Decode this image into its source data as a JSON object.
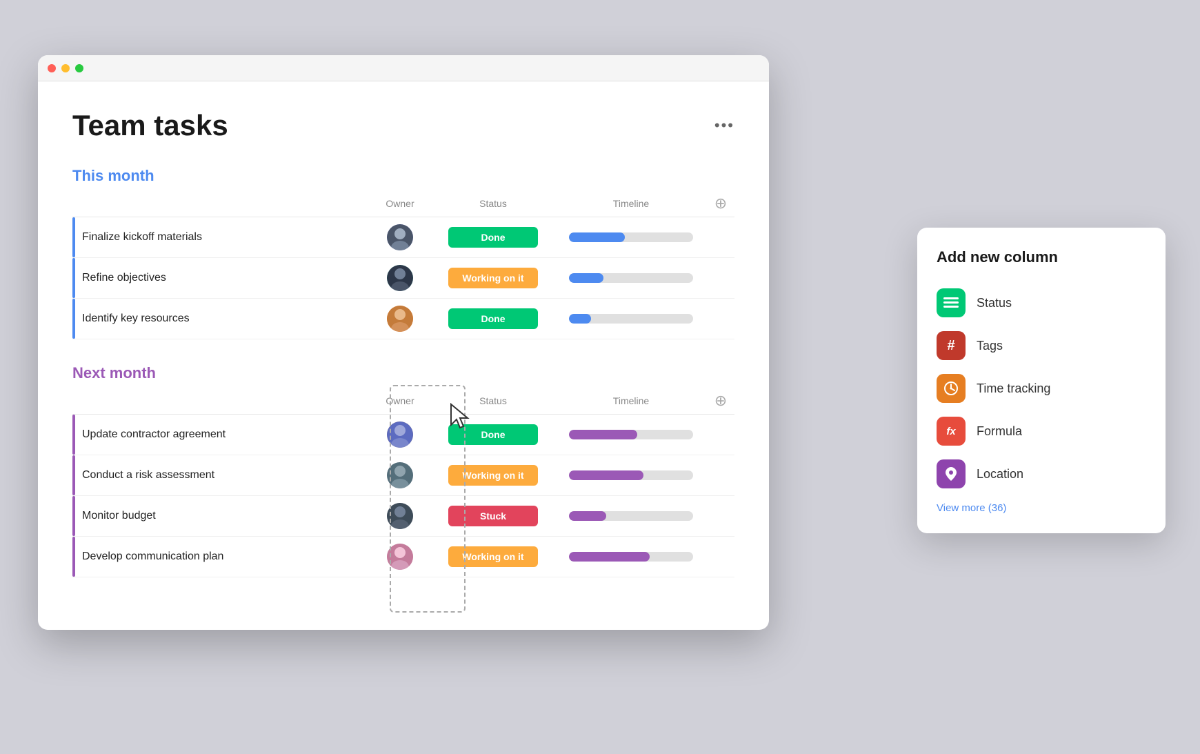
{
  "app": {
    "title": "Team tasks",
    "more_label": "•••"
  },
  "this_month": {
    "label": "This month",
    "columns": {
      "owner": "Owner",
      "status": "Status",
      "timeline": "Timeline"
    },
    "tasks": [
      {
        "name": "Finalize kickoff materials",
        "status": "Done",
        "status_class": "status-done",
        "timeline_pct": 45,
        "timeline_color": "#4d8af0"
      },
      {
        "name": "Refine objectives",
        "status": "Working on it",
        "status_class": "status-working",
        "timeline_pct": 28,
        "timeline_color": "#4d8af0"
      },
      {
        "name": "Identify key resources",
        "status": "Done",
        "status_class": "status-done",
        "timeline_pct": 18,
        "timeline_color": "#4d8af0"
      }
    ]
  },
  "next_month": {
    "label": "Next month",
    "columns": {
      "owner": "Owner",
      "status": "Status",
      "timeline": "Timeline"
    },
    "tasks": [
      {
        "name": "Update contractor agreement",
        "status": "Done",
        "status_class": "status-done",
        "timeline_pct": 55,
        "timeline_color": "#9b59b6"
      },
      {
        "name": "Conduct a risk assessment",
        "status": "Working on it",
        "status_class": "status-working",
        "timeline_pct": 60,
        "timeline_color": "#9b59b6"
      },
      {
        "name": "Monitor budget",
        "status": "Stuck",
        "status_class": "status-stuck",
        "timeline_pct": 30,
        "timeline_color": "#9b59b6"
      },
      {
        "name": "Develop communication plan",
        "status": "Working on it",
        "status_class": "status-working",
        "timeline_pct": 65,
        "timeline_color": "#9b59b6"
      }
    ]
  },
  "popup": {
    "title": "Add new column",
    "options": [
      {
        "label": "Status",
        "icon_class": "icon-status",
        "icon_char": "≡"
      },
      {
        "label": "Tags",
        "icon_class": "icon-tags",
        "icon_char": "#"
      },
      {
        "label": "Time tracking",
        "icon_class": "icon-time",
        "icon_char": "◑"
      },
      {
        "label": "Formula",
        "icon_class": "icon-formula",
        "icon_char": "fx"
      },
      {
        "label": "Location",
        "icon_class": "icon-location",
        "icon_char": "📍"
      }
    ],
    "view_more": "View more (36)"
  }
}
